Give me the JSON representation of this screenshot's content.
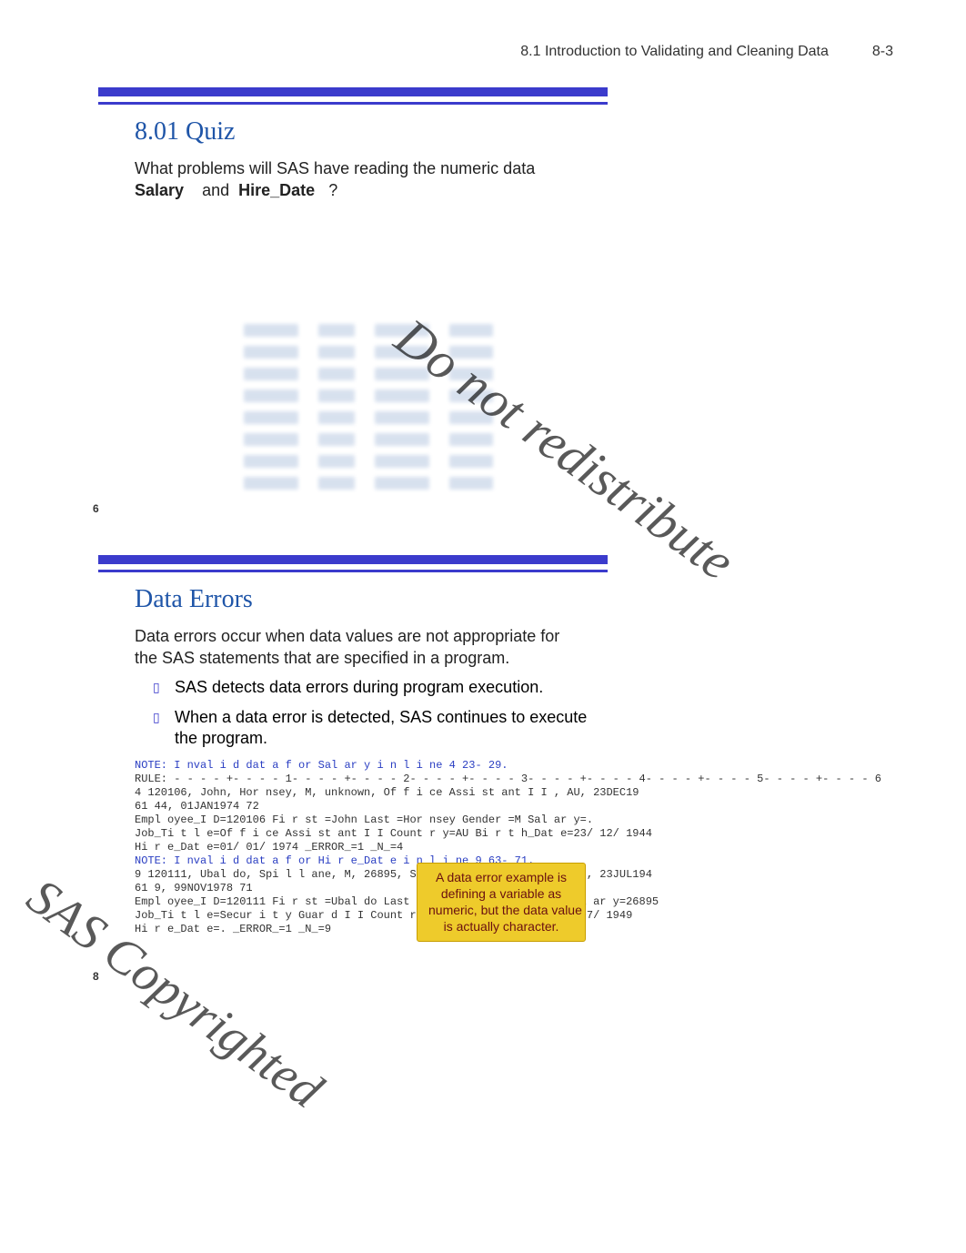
{
  "header": {
    "section": "8.1   Introduction to Validating and Cleaning Data",
    "page": "8-3"
  },
  "quiz": {
    "title": "8.01 Quiz",
    "prompt_a": "What problems will SAS have reading the numeric data",
    "salary": "Salary",
    "and": "and",
    "hire_date": "Hire_Date",
    "qmark": "?",
    "slide_num": "6"
  },
  "errors": {
    "title": "Data Errors",
    "para_a": "Data errors occur when data values are not appropriate for the SAS statements that are specified in a program.",
    "bullet1": "SAS detects data errors during program execution.",
    "bullet2": "When a data error is detected, SAS continues to execute the program.",
    "log": {
      "l1": "NOTE: I nval i d dat a f or Sal ar y i n l i ne 4 23- 29.",
      "l2": "RULE:         - - - - +- - - - 1- - - - +- - - - 2- - - - +- - - - 3- - - - +- - - - 4- - - - +- - - - 5- - - - +- - - - 6",
      "l3": "4             120106, John, Hor nsey, M, unknown, Of f i ce Assi st ant I I , AU, 23DEC19",
      "l4": "        61    44, 01JAN1974 72",
      "l5": "Empl oyee_I D=120106 Fi r st =John Last =Hor nsey Gender =M Sal ar y=.",
      "l6": "Job_Ti t l e=Of f i ce Assi st ant I I Count r y=AU Bi r t h_Dat e=23/ 12/ 1944",
      "l7": "Hi r e_Dat e=01/ 01/ 1974 _ERROR_=1 _N_=4",
      "l8": "NOTE: I nval i d dat a f or Hi r e_Dat e i n l i ne 9 63- 71.",
      "l9": "9             120111, Ubal do, Spi l l ane, M, 26895, Secur i t y Guar d I I , AU, 23JUL194",
      "l10": "        61    9, 99NOV1978 71",
      "l11": "Empl oyee_I D=120111 Fi r st =Ubal do Last =Spi l l ane Gender =M Sal ar y=26895",
      "l12": "Job_Ti t l e=Secur i t y Guar d I I Count r y=AU Bi r t h_Dat e=23/ 07/ 1949",
      "l13": "Hi r e_Dat e=. _ERROR_=1 _N_=9"
    },
    "callout": {
      "line1": "A data error example is",
      "line2": "defining a variable as",
      "line3": "numeric, but the data value",
      "line4": "is actually character."
    },
    "slide_num": "8"
  },
  "watermark": {
    "copyrighted": "SAS Copyrighted",
    "donot": "Do not redistribute"
  }
}
